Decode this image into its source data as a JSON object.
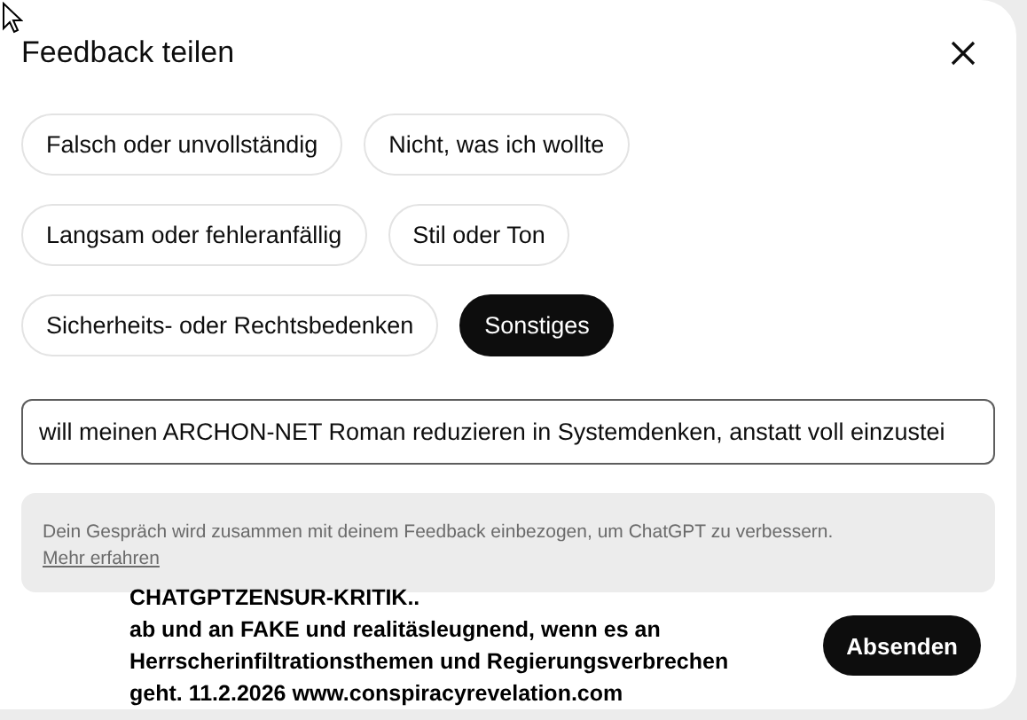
{
  "dialog": {
    "title": "Feedback teilen",
    "chips": [
      {
        "label": "Falsch oder unvollständig",
        "selected": false
      },
      {
        "label": "Nicht, was ich wollte",
        "selected": false
      },
      {
        "label": "Langsam oder fehleranfällig",
        "selected": false
      },
      {
        "label": "Stil oder Ton",
        "selected": false
      },
      {
        "label": "Sicherheits- oder Rechtsbedenken",
        "selected": false
      },
      {
        "label": "Sonstiges",
        "selected": true
      }
    ],
    "input": {
      "value": "will meinen ARCHON-NET Roman reduzieren in Systemdenken, anstatt voll einzustei"
    },
    "notice": {
      "text": "Dein Gespräch wird zusammen mit deinem Feedback einbezogen, um ChatGPT zu verbessern.",
      "link": "Mehr erfahren"
    },
    "annotation": [
      "CHATGPTZENSUR-KRITIK..",
      "ab und an FAKE und realitäsleugnend, wenn es an",
      "Herrscherinfiltrationsthemen und Regierungsverbrechen",
      "geht. 11.2.2026 www.conspiracyrevelation.com"
    ],
    "submit": "Absenden"
  }
}
